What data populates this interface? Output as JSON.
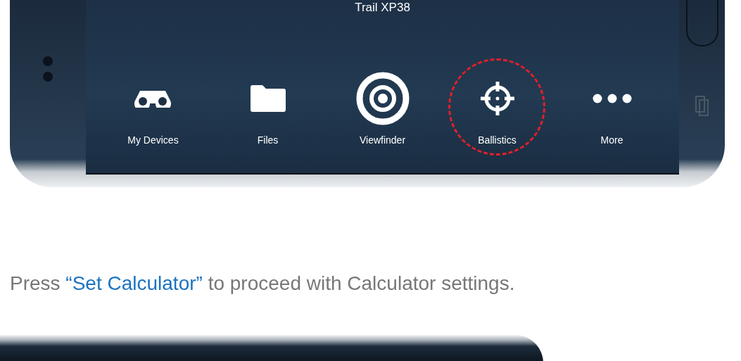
{
  "app": {
    "title": "Trail XP38",
    "nav": [
      {
        "label": "My Devices",
        "kind": "binoculars",
        "highlighted": false
      },
      {
        "label": "Files",
        "kind": "folder",
        "highlighted": false
      },
      {
        "label": "Viewfinder",
        "kind": "target",
        "highlighted": false
      },
      {
        "label": "Ballistics",
        "kind": "crosshair",
        "highlighted": true
      },
      {
        "label": "More",
        "kind": "more",
        "highlighted": false
      }
    ]
  },
  "instruction": {
    "before": "Press",
    "link": "“Set Calculator”",
    "after": "to proceed with Calculator settings."
  }
}
